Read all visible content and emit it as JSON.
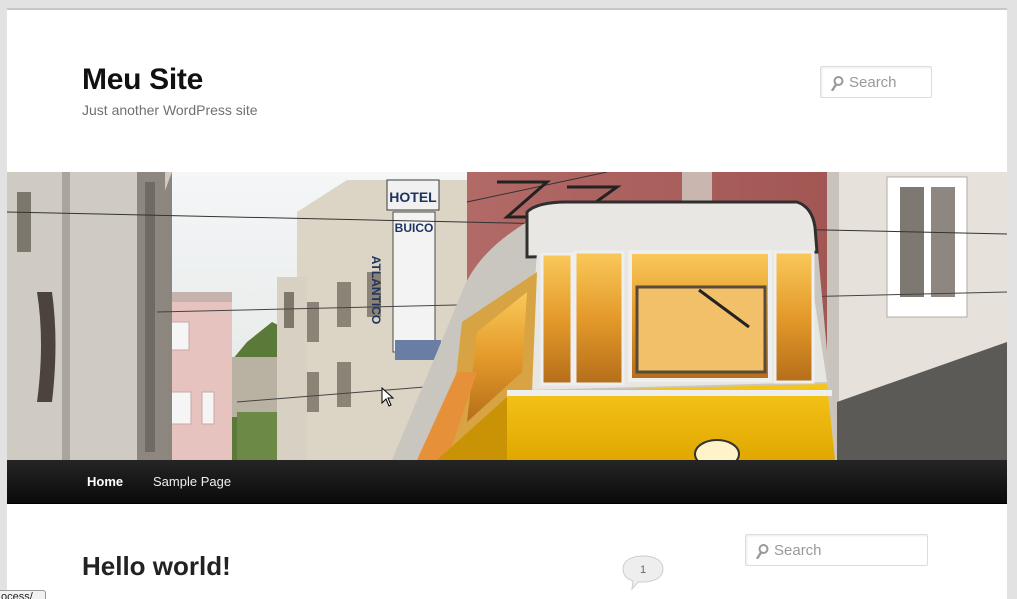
{
  "site": {
    "title": "Meu Site",
    "description": "Just another WordPress site"
  },
  "search_top": {
    "placeholder": "Search"
  },
  "search_sidebar": {
    "placeholder": "Search"
  },
  "header_image": {
    "subject": "tram",
    "sign_hotel": "HOTEL",
    "sign_name_1": "BUICO",
    "sign_name_2": "ATLANTICO"
  },
  "nav": {
    "items": [
      {
        "label": "Home",
        "active": true
      },
      {
        "label": "Sample Page",
        "active": false
      }
    ]
  },
  "post": {
    "title": "Hello world!",
    "comment_count": "1"
  },
  "status_tooltip": "ocess/",
  "colors": {
    "nav_bg": "#1a1a1a",
    "tram_yellow": "#f2b705",
    "page_bg": "#ffffff"
  }
}
